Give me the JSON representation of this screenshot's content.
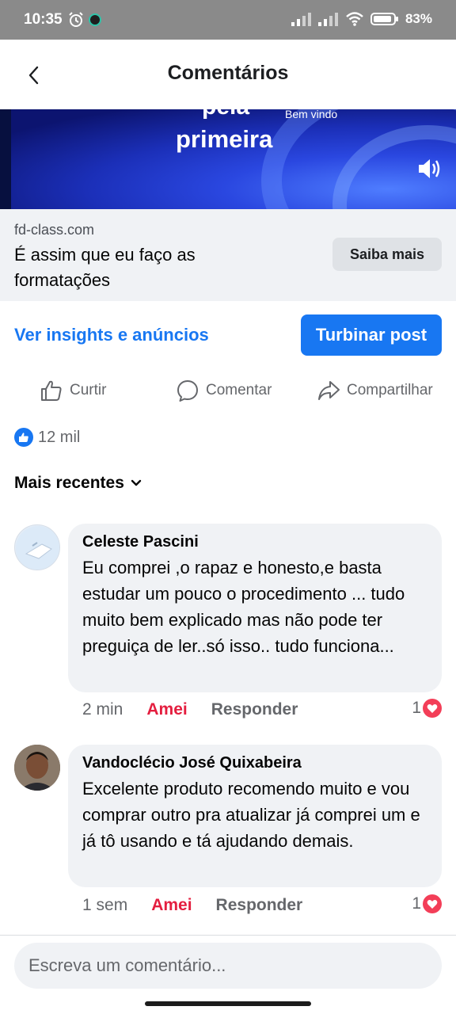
{
  "status": {
    "time": "10:35",
    "battery": "83%"
  },
  "header": {
    "title": "Comentários",
    "back_icon": "chevron-left-icon"
  },
  "ad": {
    "image_text_partial": "pela",
    "image_text_main": "primeira",
    "image_text_small": "Bem vindo",
    "domain": "fd-class.com",
    "title": "É assim que eu faço as formatações",
    "cta": "Saiba mais"
  },
  "post_actions": {
    "insights_link": "Ver insights e anúncios",
    "boost_button": "Turbinar post",
    "like": "Curtir",
    "comment": "Comentar",
    "share": "Compartilhar"
  },
  "reactions": {
    "count": "12 mil"
  },
  "sort": {
    "label": "Mais recentes"
  },
  "comments": [
    {
      "author": "Celeste Pascini",
      "text": "Eu comprei ,o rapaz e honesto,e basta estudar um pouco o procedimento ... tudo muito bem explicado mas não pode ter preguiça de ler..só isso.. tudo funciona...",
      "time": "2 min",
      "reaction_label": "Amei",
      "reply_label": "Responder",
      "reaction_count": "1"
    },
    {
      "author": "Vandoclécio José Quixabeira",
      "text": "Excelente produto recomendo muito e vou comprar outro pra atualizar já comprei um e já tô usando e tá ajudando demais.",
      "time": "1 sem",
      "reaction_label": "Amei",
      "reply_label": "Responder",
      "reaction_count": "1"
    }
  ],
  "composer": {
    "placeholder": "Escreva um comentário..."
  },
  "colors": {
    "accent": "#1877f2",
    "love": "#e41e3f",
    "bubble": "#f0f2f5"
  }
}
